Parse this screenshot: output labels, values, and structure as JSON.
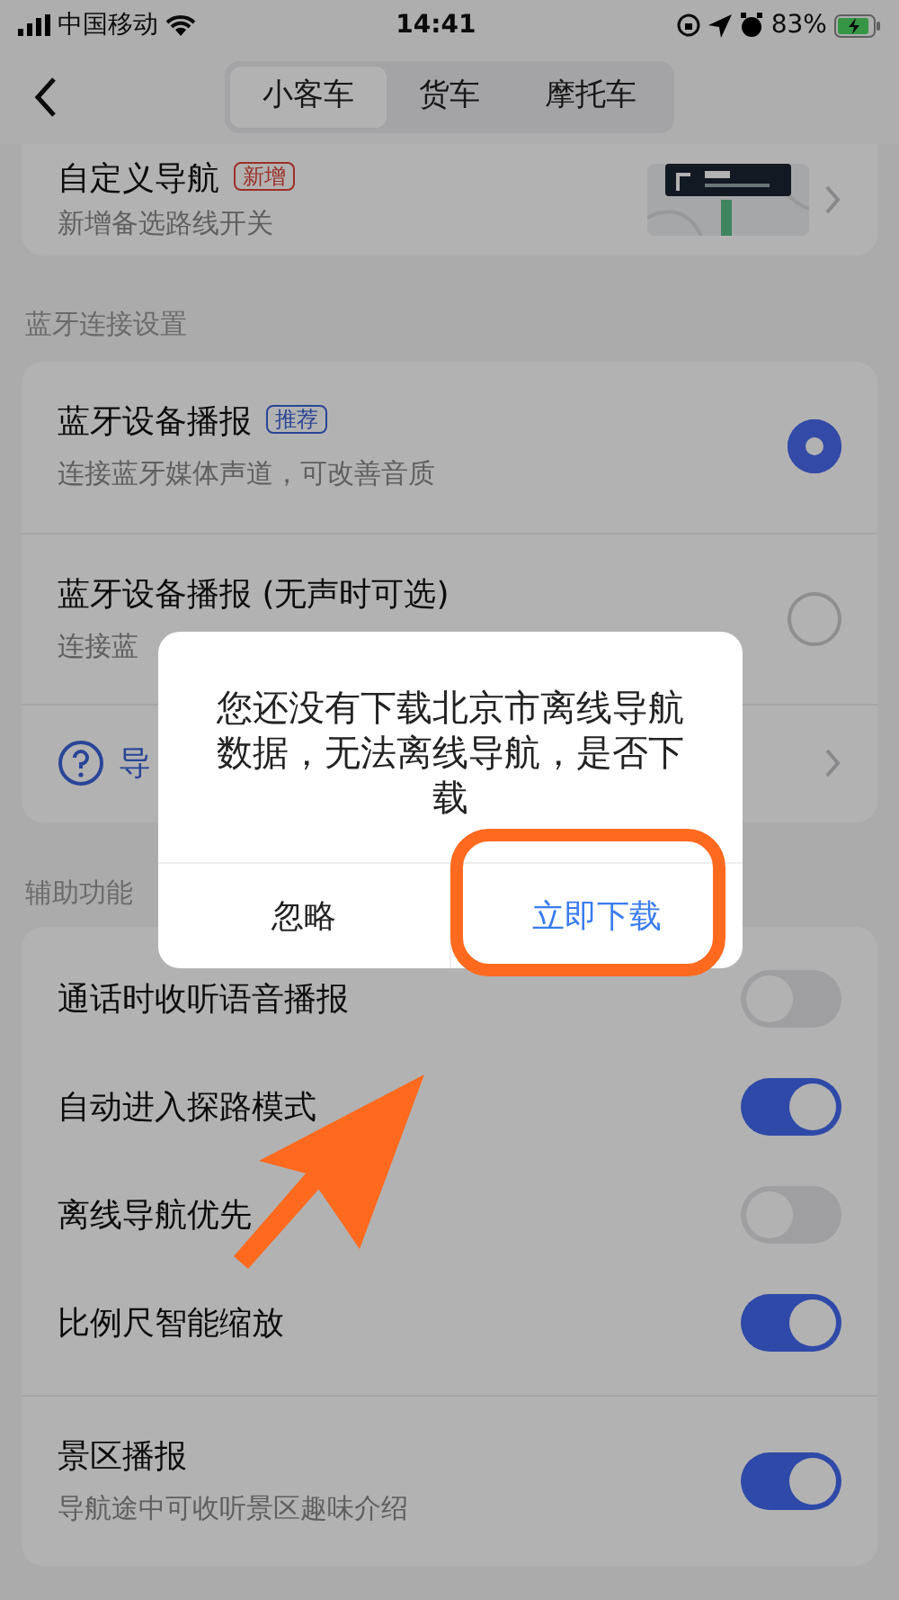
{
  "status_bar": {
    "carrier": "中国移动",
    "time": "14:41",
    "battery": "83%"
  },
  "tabs": [
    {
      "label": "小客车",
      "selected": true
    },
    {
      "label": "货车",
      "selected": false
    },
    {
      "label": "摩托车",
      "selected": false
    }
  ],
  "custom_nav": {
    "title": "自定义导航",
    "badge": "新增",
    "subtitle": "新增备选路线开关"
  },
  "bluetooth": {
    "header": "蓝牙连接设置",
    "items": [
      {
        "title": "蓝牙设备播报",
        "badge": "推荐",
        "subtitle": "连接蓝牙媒体声道，可改善音质",
        "selected": true
      },
      {
        "title": "蓝牙设备播报 (无声时可选)",
        "subtitle": "连接蓝",
        "selected": false
      }
    ],
    "help_link": "导"
  },
  "assist": {
    "header": "辅助功能",
    "items": [
      {
        "title": "通话时收听语音播报",
        "on": false
      },
      {
        "title": "自动进入探路模式",
        "on": true
      },
      {
        "title": "离线导航优先",
        "on": false
      },
      {
        "title": "比例尺智能缩放",
        "on": true
      },
      {
        "title": "景区播报",
        "subtitle": "导航途中可收听景区趣味介绍",
        "on": true
      }
    ]
  },
  "dialog": {
    "message": "您还没有下载北京市离线导航数据，无法离线导航，是否下载",
    "buttons": [
      {
        "label": "忽略",
        "kind": "secondary"
      },
      {
        "label": "立即下载",
        "kind": "primary"
      }
    ]
  },
  "annotations": {
    "highlight_frame": true,
    "pointer_arrow": true
  }
}
